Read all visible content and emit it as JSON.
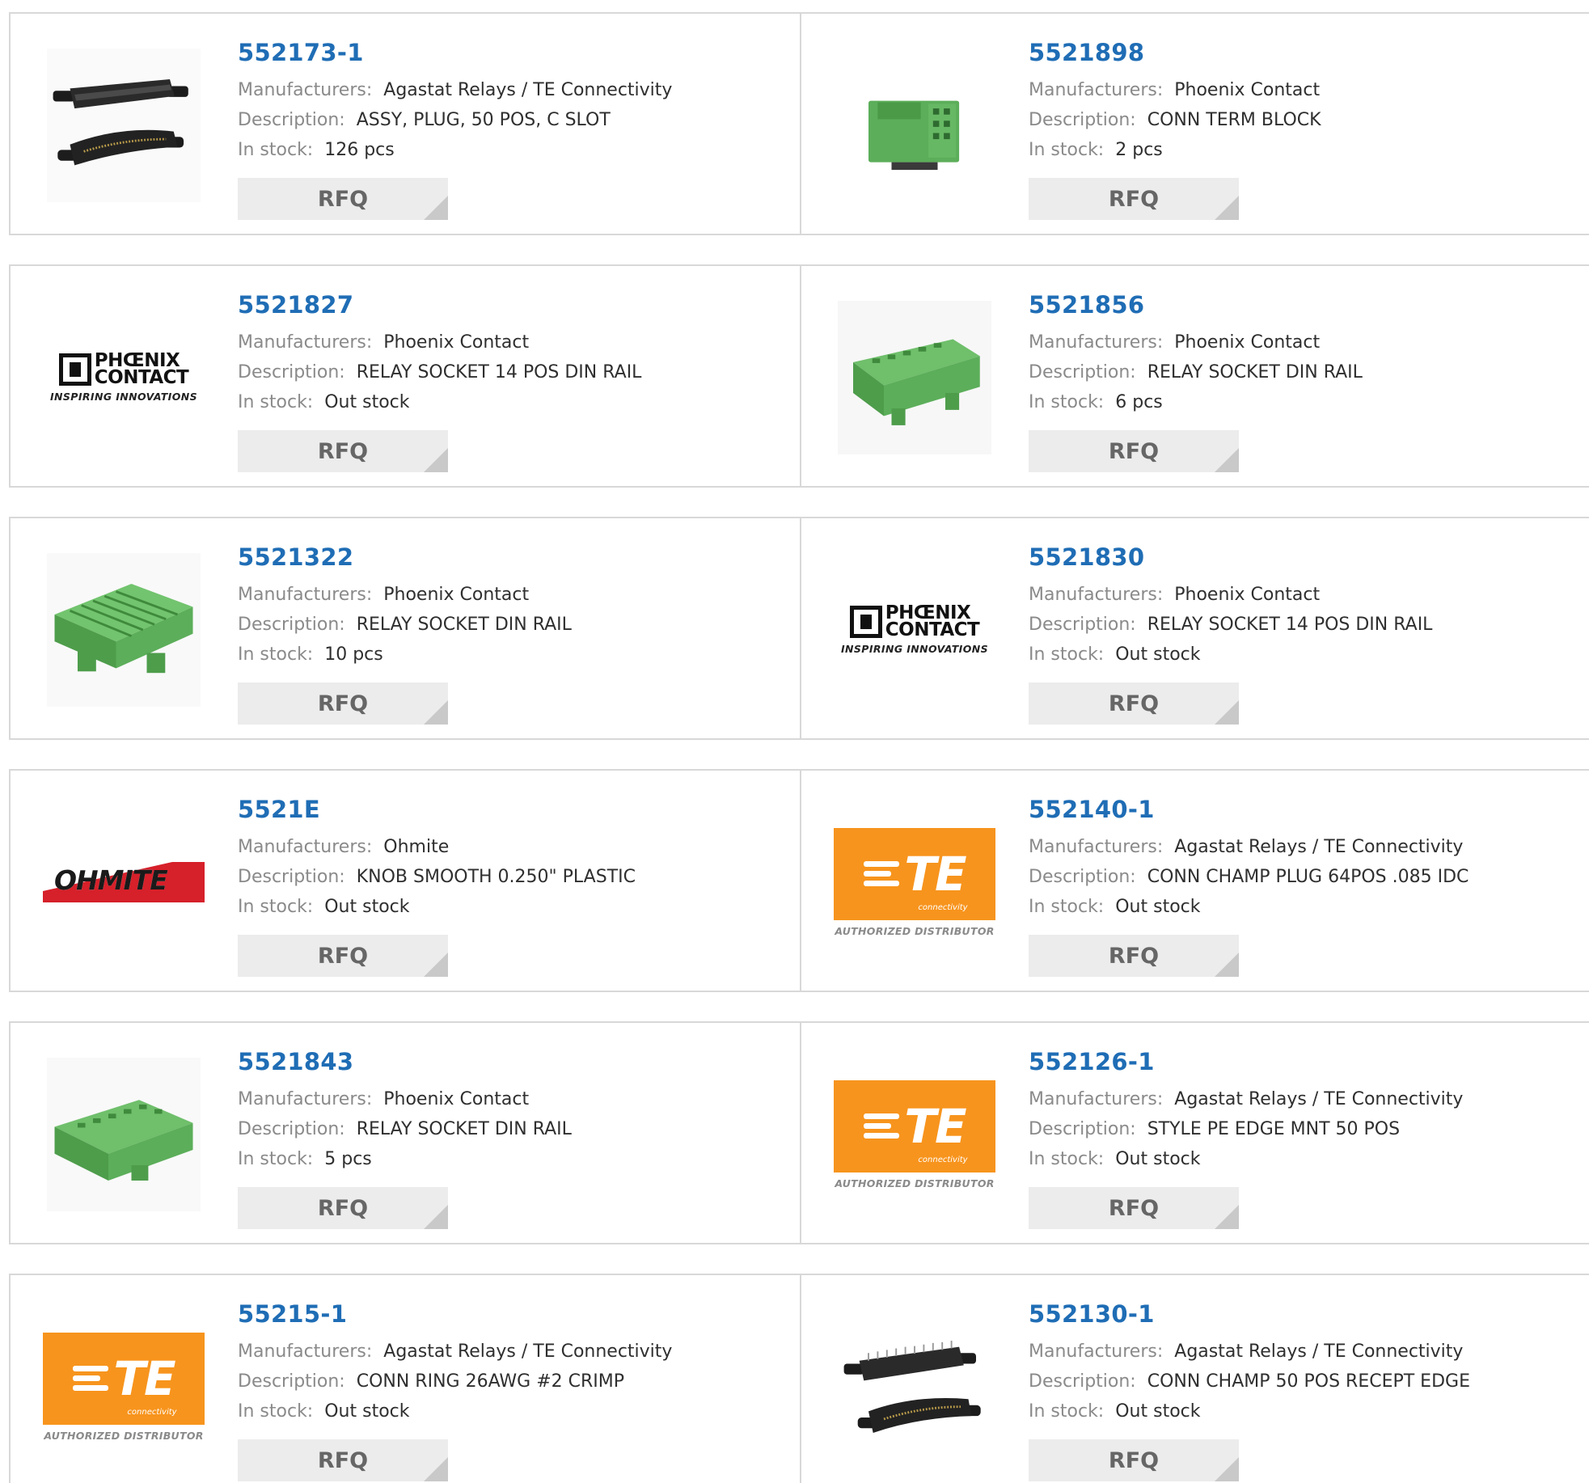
{
  "labels": {
    "manufacturers": "Manufacturers:",
    "description": "Description:",
    "stock": "In stock:",
    "rfq": "RFQ"
  },
  "logos": {
    "phoenix": {
      "line1": "PHŒNIX",
      "line2": "CONTACT",
      "tag": "INSPIRING INNOVATIONS"
    },
    "te": {
      "mark": "TE",
      "sub": "connectivity",
      "tag": "AUTHORIZED DISTRIBUTOR"
    },
    "ohmite": {
      "text": "OHMITE"
    }
  },
  "products": [
    {
      "part": "552173-1",
      "manufacturer": "Agastat Relays / TE Connectivity",
      "description": "ASSY, PLUG, 50 POS, C SLOT",
      "stock": "126 pcs",
      "image": "black-connector-pair"
    },
    {
      "part": "5521898",
      "manufacturer": "Phoenix Contact",
      "description": "CONN TERM BLOCK",
      "stock": "2 pcs",
      "image": "green-term-block"
    },
    {
      "part": "5521827",
      "manufacturer": "Phoenix Contact",
      "description": "RELAY SOCKET 14 POS DIN RAIL",
      "stock": "Out stock",
      "image": "phoenix-logo"
    },
    {
      "part": "5521856",
      "manufacturer": "Phoenix Contact",
      "description": "RELAY SOCKET DIN RAIL",
      "stock": "6 pcs",
      "image": "green-relay-socket"
    },
    {
      "part": "5521322",
      "manufacturer": "Phoenix Contact",
      "description": "RELAY SOCKET DIN RAIL",
      "stock": "10 pcs",
      "image": "green-relay-socket-wide"
    },
    {
      "part": "5521830",
      "manufacturer": "Phoenix Contact",
      "description": "RELAY SOCKET 14 POS DIN RAIL",
      "stock": "Out stock",
      "image": "phoenix-logo"
    },
    {
      "part": "5521E",
      "manufacturer": "Ohmite",
      "description": "KNOB SMOOTH 0.250\" PLASTIC",
      "stock": "Out stock",
      "image": "ohmite-logo"
    },
    {
      "part": "552140-1",
      "manufacturer": "Agastat Relays / TE Connectivity",
      "description": "CONN CHAMP PLUG 64POS .085 IDC",
      "stock": "Out stock",
      "image": "te-logo"
    },
    {
      "part": "5521843",
      "manufacturer": "Phoenix Contact",
      "description": "RELAY SOCKET DIN RAIL",
      "stock": "5 pcs",
      "image": "green-relay-socket"
    },
    {
      "part": "552126-1",
      "manufacturer": "Agastat Relays / TE Connectivity",
      "description": "STYLE PE EDGE MNT 50 POS",
      "stock": "Out stock",
      "image": "te-logo"
    },
    {
      "part": "55215-1",
      "manufacturer": "Agastat Relays / TE Connectivity",
      "description": "CONN RING 26AWG #2 CRIMP",
      "stock": "Out stock",
      "image": "te-logo"
    },
    {
      "part": "552130-1",
      "manufacturer": "Agastat Relays / TE Connectivity",
      "description": "CONN CHAMP 50 POS RECEPT EDGE",
      "stock": "Out stock",
      "image": "black-connector-pair-pins"
    }
  ],
  "colors": {
    "part_link": "#1f6db5",
    "te_orange": "#f7941d",
    "ohmite_red": "#d6202a",
    "component_green": "#5cae5a"
  }
}
